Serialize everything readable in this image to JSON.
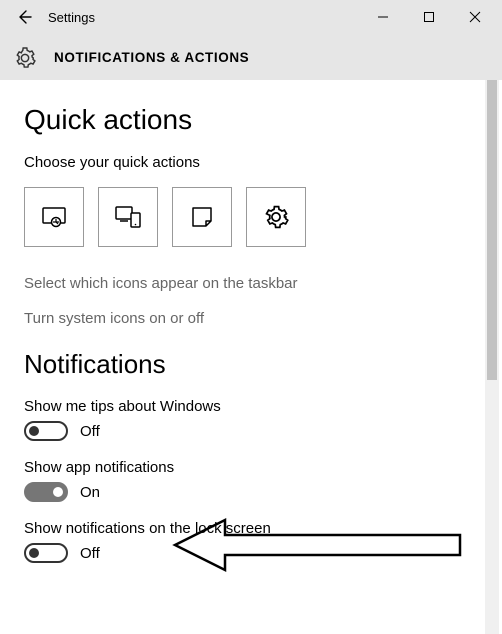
{
  "window": {
    "title": "Settings",
    "breadcrumb": "NOTIFICATIONS & ACTIONS"
  },
  "quick_actions": {
    "heading": "Quick actions",
    "choose_label": "Choose your quick actions",
    "tiles": [
      "tablet-mode",
      "connect",
      "note",
      "all-settings"
    ],
    "link_taskbar": "Select which icons appear on the taskbar",
    "link_system_icons": "Turn system icons on or off"
  },
  "notifications": {
    "heading": "Notifications",
    "settings": [
      {
        "label": "Show me tips about Windows",
        "state": "Off",
        "on": false
      },
      {
        "label": "Show app notifications",
        "state": "On",
        "on": true
      },
      {
        "label": "Show notifications on the lock screen",
        "state": "Off",
        "on": false
      }
    ]
  }
}
